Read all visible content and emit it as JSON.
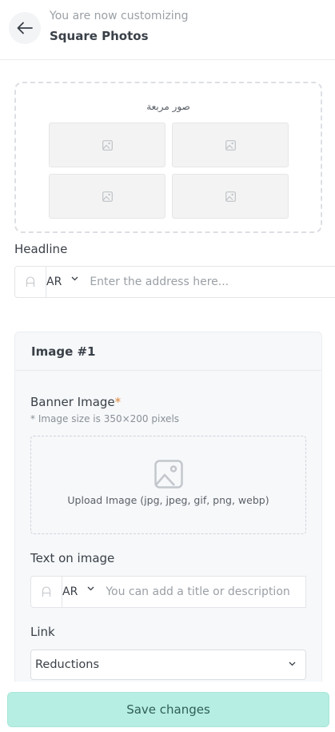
{
  "header": {
    "subtitle": "You are now customizing",
    "title": "Square Photos"
  },
  "preview": {
    "title": "صور مربعة"
  },
  "headline": {
    "label": "Headline",
    "lang_code": "AR",
    "placeholder": "Enter the address here..."
  },
  "image_panel": {
    "title": "Image #1",
    "banner_label": "Banner Image",
    "required_mark": "*",
    "size_hint": "* Image size is 350×200 pixels",
    "upload_text": "Upload Image (jpg, jpeg, gif, png, webp)",
    "text_on_image_label": "Text on image",
    "text_lang_code": "AR",
    "text_placeholder": "You can add a title or description",
    "link_label": "Link",
    "link_value": "Reductions"
  },
  "footer": {
    "save_label": "Save changes"
  },
  "colors": {
    "accent": "#b6eee3",
    "required": "#e0873a"
  }
}
